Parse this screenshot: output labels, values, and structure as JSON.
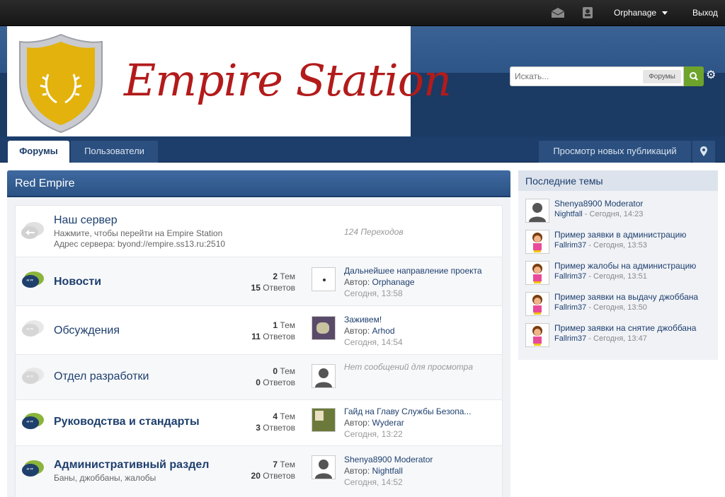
{
  "topbar": {
    "user": "Orphanage",
    "logout": "Выход"
  },
  "logo": {
    "text": "Empire Station"
  },
  "search": {
    "placeholder": "Искать...",
    "scope": "Форумы"
  },
  "nav": {
    "tab_forums": "Форумы",
    "tab_users": "Пользователи",
    "new_posts": "Просмотр новых публикаций"
  },
  "category": {
    "title": "Red Empire",
    "forums": [
      {
        "title": "Наш сервер",
        "desc1": "Нажмите, чтобы перейти на Empire Station",
        "desc2": "Адрес сервера: byond://empire.ss13.ru:2510",
        "redirects": "124 Переходов"
      },
      {
        "title": "Новости",
        "topics_num": "2",
        "topics_label": "Тем",
        "replies_num": "15",
        "replies_label": "Ответов",
        "last_title": "Дальнейшее направление проекта",
        "last_author_label": "Автор:",
        "last_author": "Orphanage",
        "last_date": "Сегодня, 13:58"
      },
      {
        "title": "Обсуждения",
        "topics_num": "1",
        "topics_label": "Тем",
        "replies_num": "11",
        "replies_label": "Ответов",
        "last_title": "Заживем!",
        "last_author_label": "Автор:",
        "last_author": "Arhod",
        "last_date": "Сегодня, 14:54"
      },
      {
        "title": "Отдел разработки",
        "topics_num": "0",
        "topics_label": "Тем",
        "replies_num": "0",
        "replies_label": "Ответов",
        "no_posts": "Нет сообщений для просмотра"
      },
      {
        "title": "Руководства и стандарты",
        "topics_num": "4",
        "topics_label": "Тем",
        "replies_num": "3",
        "replies_label": "Ответов",
        "last_title": "Гайд на Главу Службы Безопа...",
        "last_author_label": "Автор:",
        "last_author": "Wyderar",
        "last_date": "Сегодня, 13:22"
      },
      {
        "title": "Административный раздел",
        "desc1": "Баны, джоббаны, жалобы",
        "topics_num": "7",
        "topics_label": "Тем",
        "replies_num": "20",
        "replies_label": "Ответов",
        "last_title": "Shenya8900 Moderator",
        "last_author_label": "Автор:",
        "last_author": "Nightfall",
        "last_date": "Сегодня, 14:52"
      }
    ]
  },
  "sidebar": {
    "title": "Последние темы",
    "topics": [
      {
        "title": "Shenya8900 Moderator",
        "author": "Nightfall",
        "date": " - Сегодня, 14:23"
      },
      {
        "title": "Пример заявки в администрацию",
        "author": "Fallrim37",
        "date": " - Сегодня, 13:53"
      },
      {
        "title": "Пример жалобы на администрацию",
        "author": "Fallrim37",
        "date": " - Сегодня, 13:51"
      },
      {
        "title": "Пример заявки на выдачу джоббана",
        "author": "Fallrim37",
        "date": " - Сегодня, 13:50"
      },
      {
        "title": "Пример заявки на снятие джоббана",
        "author": "Fallrim37",
        "date": " - Сегодня, 13:47"
      }
    ]
  },
  "colors": {
    "accent": "#1e3f6e",
    "header": "#2e5587",
    "logo_red": "#b31b1b",
    "shield_gold": "#e3b20c",
    "search_green": "#6ea42b"
  }
}
